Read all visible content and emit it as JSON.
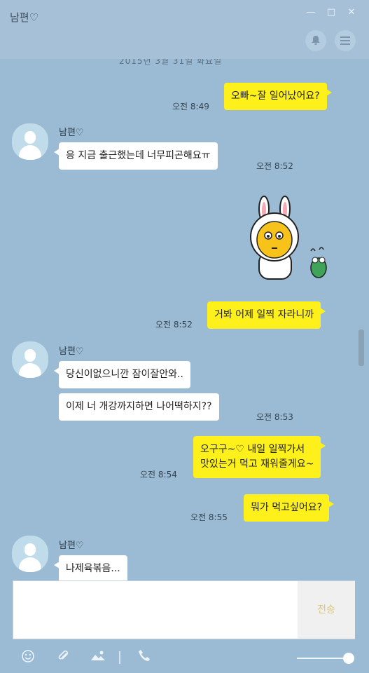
{
  "window": {
    "title": "남편♡",
    "minimize": "—",
    "maximize": "□",
    "close": "✕"
  },
  "header": {
    "bell_icon": "bell-icon",
    "menu_icon": "menu-icon"
  },
  "chat": {
    "date_fragment": "2015년 3월 31일 화요일",
    "contact_name": "남편♡",
    "messages": [
      {
        "sender": "me",
        "text": "오빠~잘 일어났어요?",
        "time": "오전 8:49"
      },
      {
        "sender": "other",
        "text": "응 지금 출근했는데 너무피곤해요ㅠ",
        "time": "오전 8:52"
      },
      {
        "sender": "me",
        "type": "sticker",
        "time": "오전 8:52"
      },
      {
        "sender": "me",
        "text": "거봐 어제 일찍 자라니까",
        "time": "오전 8:52"
      },
      {
        "sender": "other",
        "text": "당신이없으니깐 잠이잘안와..",
        "time": ""
      },
      {
        "sender": "other",
        "text": "이제 너 개강까지하면 나어떡하지??",
        "time": "오전 8:53"
      },
      {
        "sender": "me",
        "text": "오구구~♡ 내일 일찍가서\n맛있는거 먹고 재워줄게요~",
        "time": "오전 8:54"
      },
      {
        "sender": "me",
        "text": "뭐가 먹고싶어요?",
        "time": "오전 8:55"
      },
      {
        "sender": "other",
        "text": "나제육볶음...",
        "time": ""
      }
    ]
  },
  "input": {
    "send_label": "전송"
  },
  "toolbar": {
    "emoji_icon": "emoji-icon",
    "attach_icon": "paperclip-icon",
    "image_icon": "image-icon",
    "call_icon": "phone-icon"
  },
  "colors": {
    "background": "#9bbbd4",
    "my_bubble": "#fef01b",
    "other_bubble": "#ffffff"
  }
}
